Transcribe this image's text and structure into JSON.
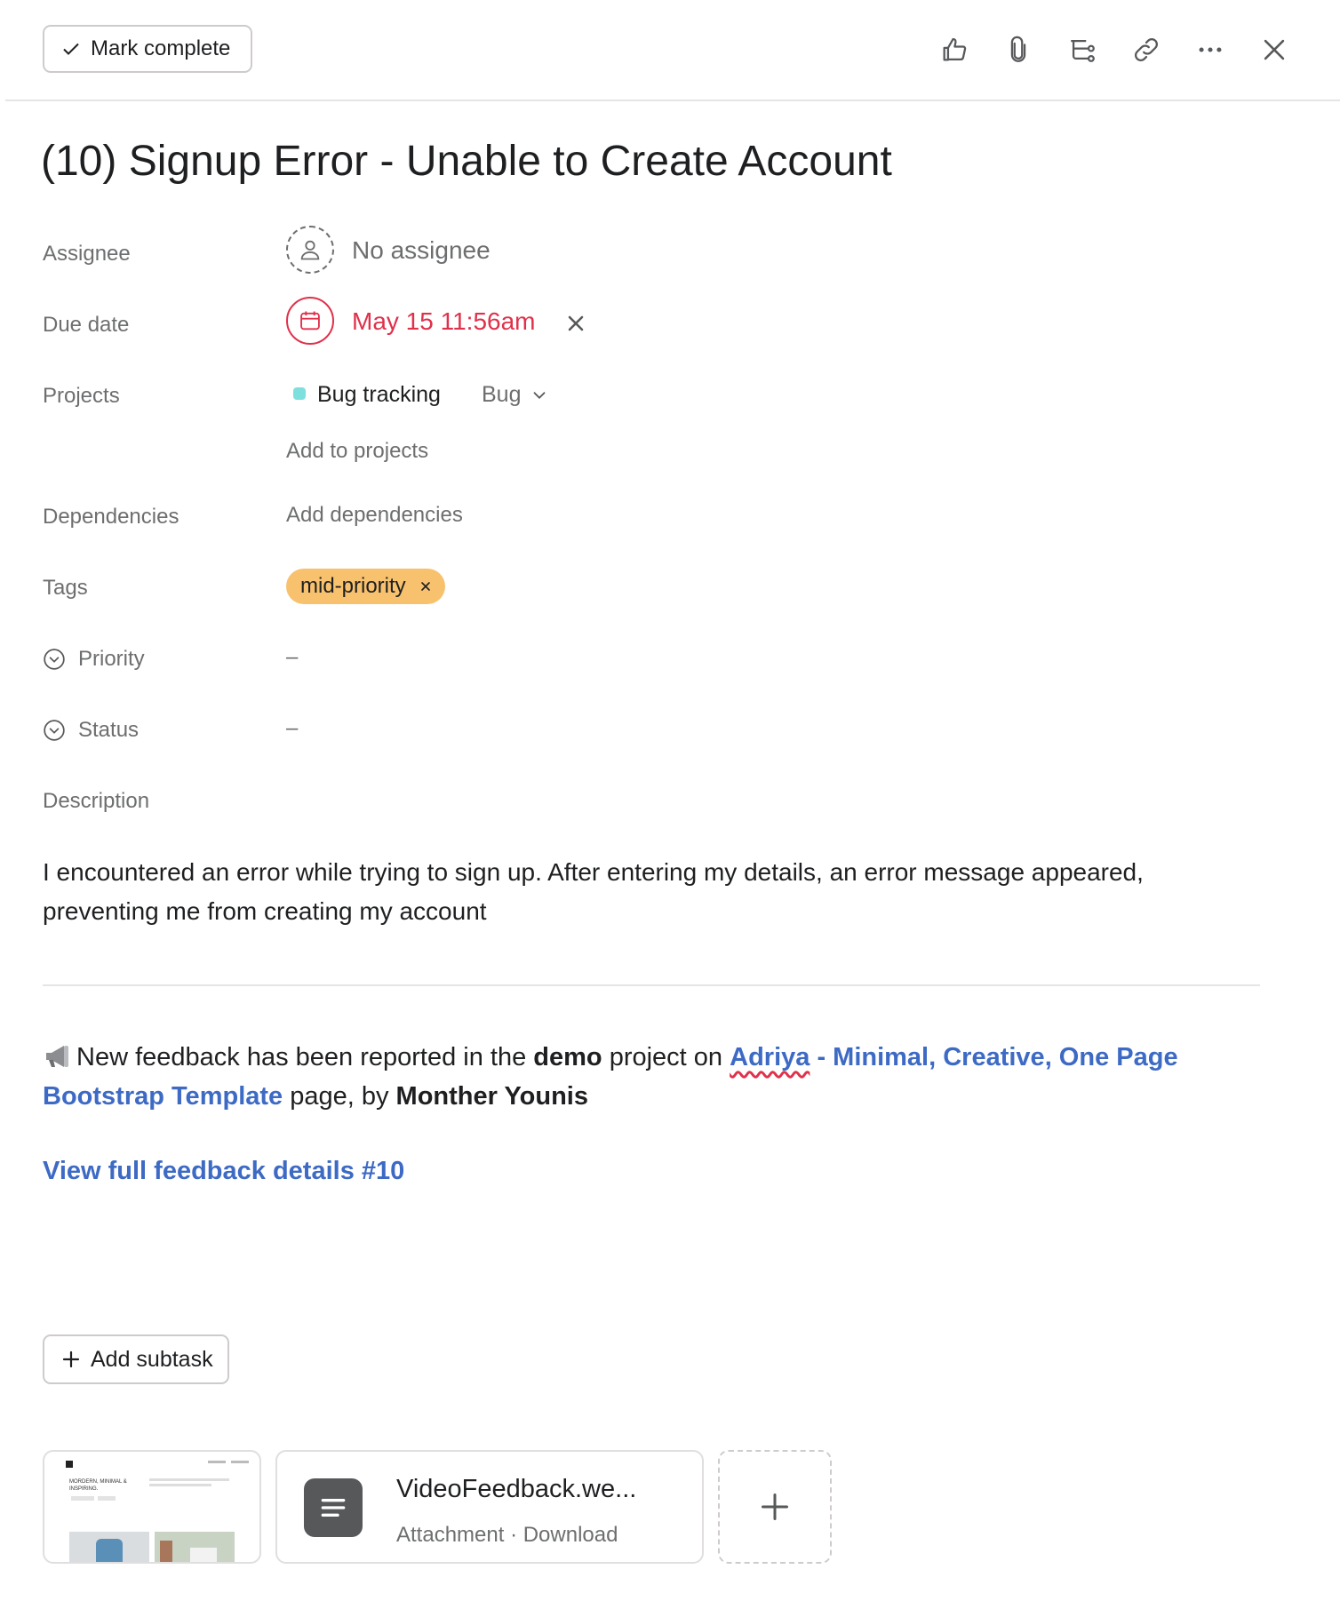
{
  "toolbar": {
    "mark_complete": "Mark complete",
    "icons": [
      "thumbs-up-icon",
      "paperclip-icon",
      "subtask-icon",
      "link-icon",
      "more-icon",
      "close-icon"
    ]
  },
  "task": {
    "title": "(10) Signup Error - Unable to Create Account"
  },
  "fields": {
    "assignee_label": "Assignee",
    "assignee_value": "No assignee",
    "due_label": "Due date",
    "due_value": "May 15 11:56am",
    "projects_label": "Projects",
    "project_name": "Bug tracking",
    "project_section": "Bug",
    "add_to_projects": "Add to projects",
    "dependencies_label": "Dependencies",
    "add_dependencies": "Add dependencies",
    "tags_label": "Tags",
    "tag_name": "mid-priority",
    "priority_label": "Priority",
    "priority_value": "–",
    "status_label": "Status",
    "status_value": "–",
    "description_label": "Description"
  },
  "description": {
    "body": "I encountered an error while trying to sign up. After entering my details, an error message appeared, preventing me from creating my account",
    "feedback_prefix": "New feedback has been reported in the ",
    "feedback_project": "demo",
    "feedback_mid": " project on ",
    "feedback_page_word1": "Adriya",
    "feedback_page_rest": " - Minimal, Creative, One Page Bootstrap Template",
    "feedback_page_suffix": " page, by ",
    "feedback_author": "Monther Younis",
    "view_link": "View full feedback details #10"
  },
  "subtasks": {
    "add_label": "Add subtask"
  },
  "attachments": {
    "thumb_caption": "MORDERN, MINIMAL & INSPIRING.",
    "file_name": "VideoFeedback.we...",
    "file_meta": "Attachment · Download"
  },
  "colors": {
    "due_red": "#e0314b",
    "project_dot": "#7ee0dc",
    "tag_bg": "#f8c16e",
    "link_blue": "#3d6ac4",
    "muted": "#6d6e6f"
  }
}
